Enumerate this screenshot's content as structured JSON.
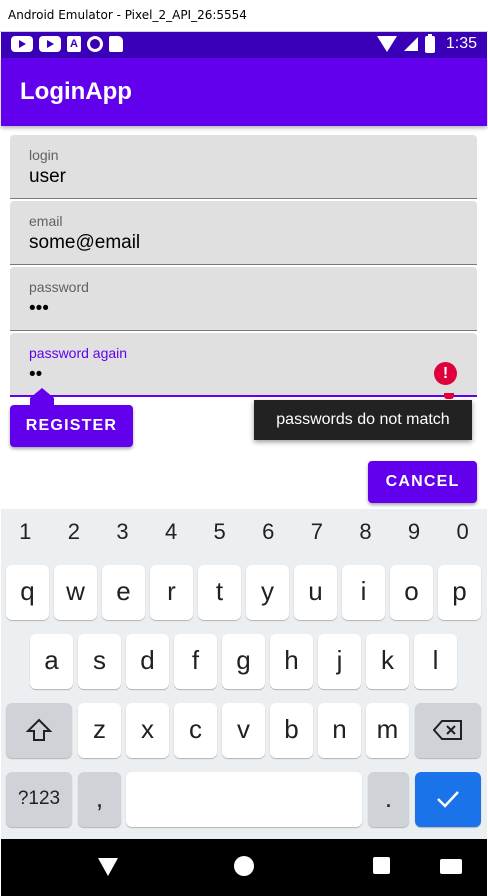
{
  "window": {
    "title": "Android Emulator - Pixel_2_API_26:5554"
  },
  "status_bar": {
    "time": "1:35",
    "background": "#3a00b8"
  },
  "app_bar": {
    "title": "LoginApp",
    "color": "#6200ee"
  },
  "form": {
    "fields": [
      {
        "label": "login",
        "value": "user"
      },
      {
        "label": "email",
        "value": "some@email"
      },
      {
        "label": "password",
        "value": "•••"
      },
      {
        "label": "password again",
        "value": "••"
      }
    ],
    "error_icon": "!",
    "error_message": "passwords do not match",
    "register_label": "REGISTER",
    "cancel_label": "CANCEL"
  },
  "keyboard": {
    "numbers": [
      "1",
      "2",
      "3",
      "4",
      "5",
      "6",
      "7",
      "8",
      "9",
      "0"
    ],
    "row1": [
      "q",
      "w",
      "e",
      "r",
      "t",
      "y",
      "u",
      "i",
      "o",
      "p"
    ],
    "row2": [
      "a",
      "s",
      "d",
      "f",
      "g",
      "h",
      "j",
      "k",
      "l"
    ],
    "row3": [
      "z",
      "x",
      "c",
      "v",
      "b",
      "n",
      "m"
    ],
    "symbols_key": "?123",
    "comma_key": ",",
    "period_key": "."
  },
  "icons": {
    "status": [
      "youtube-icon",
      "youtube-icon",
      "accessibility-icon",
      "circle-icon",
      "sd-card-icon",
      "wifi-icon",
      "signal-icon",
      "battery-icon"
    ],
    "nav": [
      "back-icon",
      "home-icon",
      "recents-icon",
      "keyboard-icon"
    ]
  }
}
